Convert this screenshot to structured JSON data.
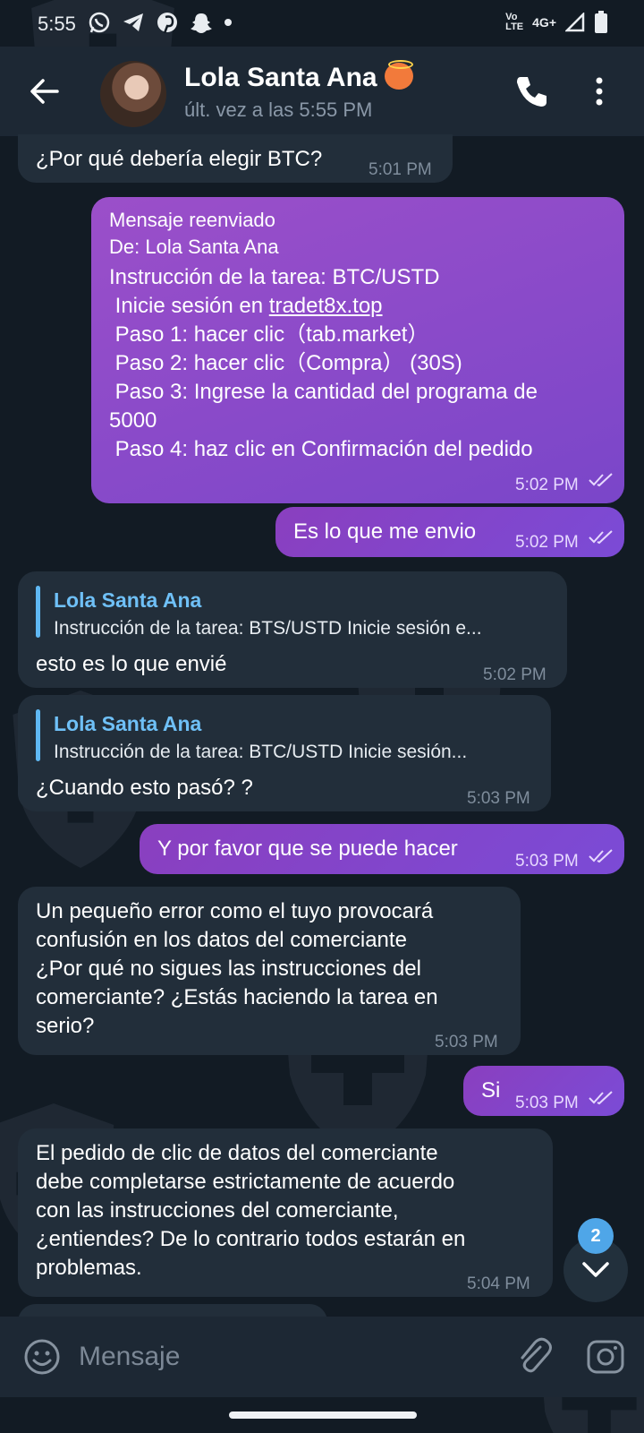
{
  "status_bar": {
    "time": "5:55",
    "volte": "Vo\nLTE",
    "network": "4G+"
  },
  "header": {
    "name": "Lola Santa Ana",
    "last_seen": "últ. vez a las 5:55 PM"
  },
  "messages": {
    "m1": {
      "text": "¿Por qué debería elegir BTC?",
      "time": "5:01 PM"
    },
    "m2": {
      "forward_label": "Mensaje reenviado",
      "forward_from": "De: Lola Santa Ana",
      "line1": "Instrucción de la tarea: BTC/USTD",
      "line2_prefix": " Inicie sesión en ",
      "line2_link": "tradet8x.top",
      "line3": " Paso 1: hacer clic（tab.market）",
      "line4": " Paso 2: hacer clic（Compra） (30S)",
      "line5a": " Paso 3: Ingrese la cantidad del programa de",
      "line5b": "5000",
      "line6": " Paso 4: haz clic en Confirmación del pedido",
      "time": "5:02 PM"
    },
    "m3": {
      "text": "Es lo que me envio",
      "time": "5:02 PM"
    },
    "m4": {
      "reply_name": "Lola Santa Ana",
      "reply_text": "Instrucción de la tarea: BTS/USTD  Inicie sesión e...",
      "text": "esto es lo que envié",
      "time": "5:02 PM"
    },
    "m5": {
      "reply_name": "Lola Santa Ana",
      "reply_text": "Instrucción de la tarea: BTC/USTD  Inicie sesión...",
      "text": "¿Cuando esto pasó? ?",
      "time": "5:03 PM"
    },
    "m6": {
      "text": "Y por favor que se puede hacer",
      "time": "5:03 PM"
    },
    "m7": {
      "l1": "Un pequeño error como el tuyo provocará",
      "l2": "confusión en los datos del comerciante",
      "l3": "¿Por qué no sigues las instrucciones del",
      "l4": "comerciante? ¿Estás haciendo la tarea en",
      "l5": "serio?",
      "time": "5:03 PM"
    },
    "m8": {
      "text": "Si",
      "time": "5:03 PM"
    },
    "m9": {
      "l1": "El pedido de clic de datos del comerciante",
      "l2": "debe completarse estrictamente de acuerdo",
      "l3": "con las instrucciones del comerciante,",
      "l4": "¿entiendes? De lo contrario todos estarán en",
      "l5": "problemas.",
      "time": "5:04 PM"
    }
  },
  "scroll_badge": "2",
  "input": {
    "placeholder": "Mensaje"
  },
  "colors": {
    "background": "#121b24",
    "header": "#1d2834",
    "incoming_bubble": "#222e3a",
    "outgoing_bubble": "#7b4bd6",
    "link_blue": "#6fc0f7",
    "badge": "#4fa6e8"
  },
  "icons": [
    "back-arrow-icon",
    "phone-icon",
    "more-vert-icon",
    "whatsapp-icon",
    "telegram-icon",
    "pinterest-icon",
    "snapchat-icon",
    "signal-icon",
    "battery-icon",
    "emoji-icon",
    "attach-icon",
    "camera-icon",
    "chevron-down-icon",
    "read-ticks-icon"
  ]
}
